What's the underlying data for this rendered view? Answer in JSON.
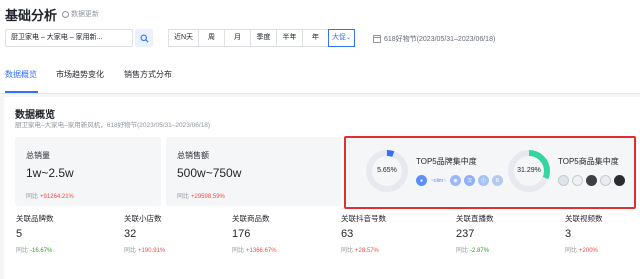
{
  "header": {
    "title": "基础分析",
    "update_note": "数据更新"
  },
  "filters": {
    "category": "厨卫家电 – 大家电 – 家用新...",
    "periods": [
      {
        "label": "近N天",
        "active": false
      },
      {
        "label": "周",
        "active": false
      },
      {
        "label": "月",
        "active": false
      },
      {
        "label": "季度",
        "active": false
      },
      {
        "label": "半年",
        "active": false
      },
      {
        "label": "年",
        "active": false
      },
      {
        "label": "大促",
        "active": true
      }
    ],
    "date_range": "618好物节(2023/05/31–2023/06/18)"
  },
  "tabs": [
    {
      "label": "数据概览",
      "active": true
    },
    {
      "label": "市场趋势变化",
      "active": false
    },
    {
      "label": "销售方式分布",
      "active": false
    }
  ],
  "overview": {
    "title": "数据概览",
    "subtitle": "厨卫家电–大家电–家用新风机，618好物节(2023/05/31–2023/06/18)",
    "cards": [
      {
        "label": "总销量",
        "value": "1w~2.5w",
        "cmp_label": "同比",
        "cmp_value": "+91264.21%"
      },
      {
        "label": "总销售额",
        "value": "500w~750w",
        "cmp_label": "同比",
        "cmp_value": "+29598.59%"
      }
    ],
    "concentration": [
      {
        "title": "TOP5品牌集中度",
        "pct": "5.65%",
        "ratio": 0.0565,
        "color": "#3370ff"
      },
      {
        "title": "TOP5商品集中度",
        "pct": "31.29%",
        "ratio": 0.3129,
        "color": "#33d6a1"
      }
    ],
    "brand_logos": [
      "●",
      "◉",
      "汉",
      "小",
      "B"
    ],
    "brand_logo_text": "~olim~"
  },
  "metrics": [
    {
      "label": "关联品牌数",
      "value": "5",
      "cmp_label": "同比",
      "cmp_value": "-16.67%",
      "dir": "down"
    },
    {
      "label": "关联小店数",
      "value": "32",
      "cmp_label": "同比",
      "cmp_value": "+190.91%",
      "dir": "up"
    },
    {
      "label": "关联商品数",
      "value": "176",
      "cmp_label": "同比",
      "cmp_value": "+1366.67%",
      "dir": "up"
    },
    {
      "label": "关联抖音号数",
      "value": "63",
      "cmp_label": "同比",
      "cmp_value": "+28.57%",
      "dir": "up"
    },
    {
      "label": "关联直播数",
      "value": "237",
      "cmp_label": "同比",
      "cmp_value": "-2.87%",
      "dir": "down"
    },
    {
      "label": "关联视频数",
      "value": "3",
      "cmp_label": "同比",
      "cmp_value": "+200%",
      "dir": "up"
    }
  ],
  "colors": {
    "accent": "#3370ff",
    "up": "#f54a45",
    "down": "#2ea121",
    "highlight": "#e0302f"
  }
}
